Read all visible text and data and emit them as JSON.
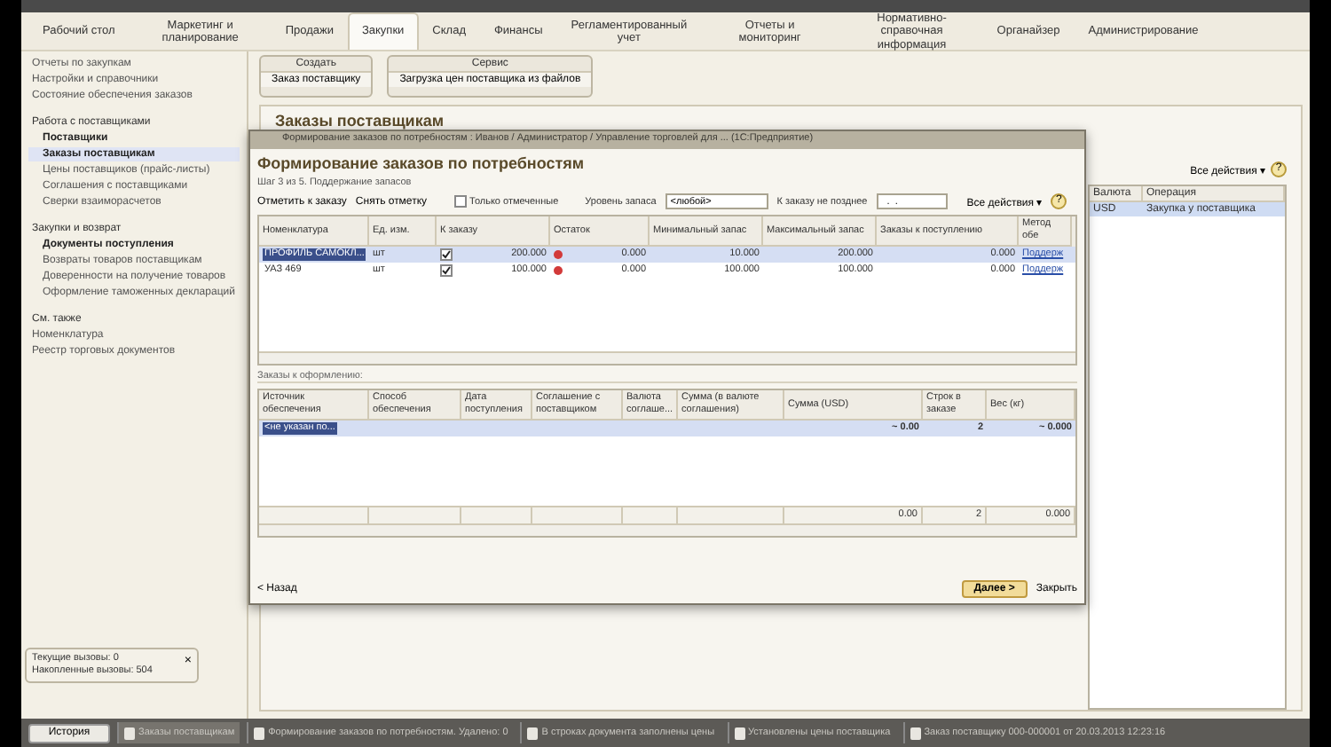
{
  "sections": [
    {
      "label": "Рабочий стол",
      "selected": false
    },
    {
      "label": "Маркетинг и планирование",
      "selected": false
    },
    {
      "label": "Продажи",
      "selected": false
    },
    {
      "label": "Закупки",
      "selected": true
    },
    {
      "label": "Склад",
      "selected": false
    },
    {
      "label": "Финансы",
      "selected": false
    },
    {
      "label": "Регламентированный учет",
      "selected": false
    },
    {
      "label": "Отчеты и мониторинг",
      "selected": false
    },
    {
      "label": "Нормативно-справочная информация",
      "selected": false
    },
    {
      "label": "Органайзер",
      "selected": false
    },
    {
      "label": "Администрирование",
      "selected": false
    }
  ],
  "sidebar": {
    "top_items": [
      "Отчеты по закупкам",
      "Настройки и справочники",
      "Состояние обеспечения заказов"
    ],
    "groups": [
      {
        "title": "Работа с поставщиками",
        "items": [
          {
            "label": "Поставщики",
            "bold": true,
            "selected": false
          },
          {
            "label": "Заказы поставщикам",
            "bold": true,
            "selected": true
          },
          {
            "label": "Цены поставщиков (прайс-листы)",
            "bold": false,
            "selected": false
          },
          {
            "label": "Соглашения с поставщиками",
            "bold": false,
            "selected": false
          },
          {
            "label": "Сверки взаиморасчетов",
            "bold": false,
            "selected": false
          }
        ]
      },
      {
        "title": "Закупки и возврат",
        "items": [
          {
            "label": "Документы поступления",
            "bold": true,
            "selected": false
          },
          {
            "label": "Возвраты товаров поставщикам",
            "bold": false,
            "selected": false
          },
          {
            "label": "Доверенности на получение товаров",
            "bold": false,
            "selected": false
          },
          {
            "label": "Оформление таможенных деклараций",
            "bold": false,
            "selected": false
          }
        ]
      }
    ],
    "see_also": {
      "title": "См. также",
      "items": [
        "Номенклатура",
        "Реестр торговых документов"
      ]
    }
  },
  "command_groups": [
    {
      "title": "Создать",
      "commands": [
        "Заказ поставщику"
      ]
    },
    {
      "title": "Сервис",
      "commands": [
        "Загрузка цен поставщика из файлов"
      ]
    }
  ],
  "page_title": "Заказы поставщикам",
  "list": {
    "all_actions": "Все действия ▾",
    "help": "?",
    "columns": [
      "Валюта",
      "Операция"
    ],
    "rows": [
      {
        "cells": [
          "USD",
          "Закупка у поставщика"
        ],
        "selected": true
      }
    ]
  },
  "dialog": {
    "window_title": "Формирование заказов по потребностям : Иванов / Администратор / Управление торговлей для ... (1С:Предприятие)",
    "heading": "Формирование заказов по потребностям",
    "step": "Шаг 3 из 5. Поддержание запасов",
    "mark_button": "Отметить к заказу",
    "unmark_button": "Снять отметку",
    "only_marked": {
      "label": "Только отмеченные",
      "checked": false
    },
    "stock_level": {
      "label": "Уровень запаса",
      "value": "<любой>"
    },
    "deadline": {
      "label": "К заказу не позднее",
      "value": "  .  .    "
    },
    "all_actions": "Все действия ▾",
    "help": "?",
    "needs_table": {
      "columns": [
        "Номенклатура",
        "Ед. изм.",
        "К заказу",
        "Остаток",
        "Минимальный запас",
        "Максимальный запас",
        "Заказы к поступлению",
        "Метод обе"
      ],
      "rows": [
        {
          "item": "ПРОФИЛЬ САМОКЛ...",
          "unit": "шт",
          "checked": true,
          "to_order": "200.000",
          "balance": "0.000",
          "min": "10.000",
          "max": "200.000",
          "incoming": "0.000",
          "method": "Поддерж",
          "selected": true
        },
        {
          "item": "УАЗ 469",
          "unit": "шт",
          "checked": true,
          "to_order": "100.000",
          "balance": "0.000",
          "min": "100.000",
          "max": "100.000",
          "incoming": "0.000",
          "method": "Поддерж",
          "selected": false
        }
      ]
    },
    "orders_label": "Заказы к оформлению:",
    "orders_table": {
      "columns": [
        "Источник обеспечения",
        "Способ обеспечения",
        "Дата поступления",
        "Соглашение с поставщиком",
        "Валюта соглаше...",
        "Сумма (в валюте соглашения)",
        "Сумма (USD)",
        "Строк в заказе",
        "Вес (кг)"
      ],
      "rows": [
        {
          "source": "<не указан по...",
          "sum_usd": "~ 0.00",
          "lines": "2",
          "weight": "~ 0.000",
          "selected": true
        }
      ],
      "totals": {
        "sum_usd": "0.00",
        "lines": "2",
        "weight": "0.000"
      }
    },
    "back_button": "< Назад",
    "next_button": "Далее >",
    "close_button": "Закрыть"
  },
  "calls_popup": {
    "lines": [
      "Текущие вызовы: 0",
      "Накопленные вызовы: 504"
    ],
    "close": "×"
  },
  "taskbar": {
    "history": "История",
    "items": [
      {
        "label": "Заказы поставщикам",
        "active": true
      },
      {
        "label": "Формирование заказов по потребностям. Удалено: 0",
        "active": false
      },
      {
        "label": "В строках документа заполнены цены",
        "active": false
      },
      {
        "label": "Установлены цены поставщика",
        "active": false
      },
      {
        "label": "Заказ поставщику 000-000001 от 20.03.2013 12:23:16",
        "active": false
      }
    ]
  }
}
